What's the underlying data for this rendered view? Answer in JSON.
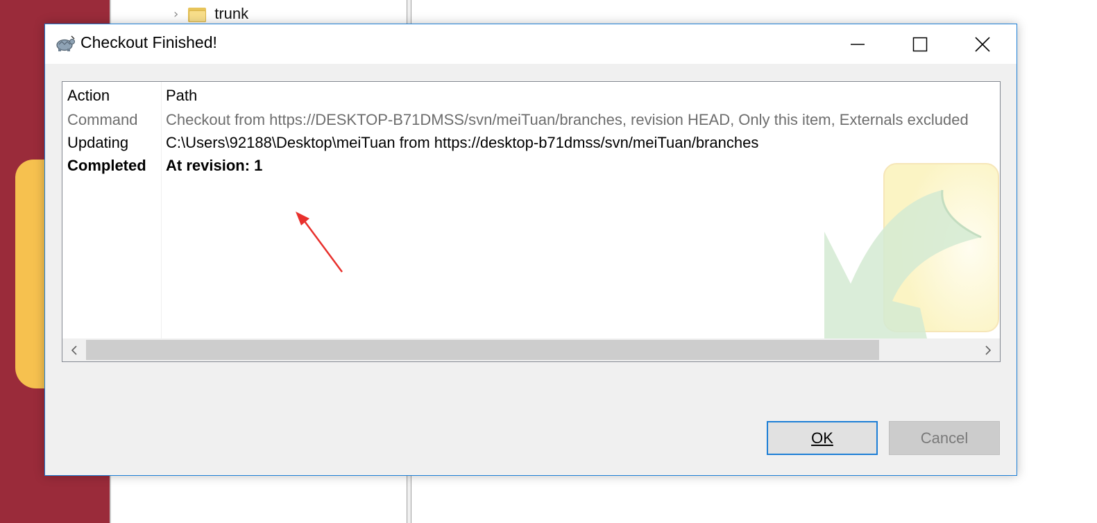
{
  "background": {
    "tree_item": {
      "label": "trunk",
      "icon": "folder-icon",
      "chevron": "›"
    }
  },
  "dialog": {
    "title": "Checkout Finished!",
    "title_icon": "tortoisesvn-icon",
    "window_buttons": [
      "minimize-icon",
      "maximize-icon",
      "close-icon"
    ],
    "columns": {
      "action": "Action",
      "path": "Path"
    },
    "rows": [
      {
        "action": "Command",
        "path": "Checkout from https://DESKTOP-B71DMSS/svn/meiTuan/branches, revision HEAD, Only this item, Externals excluded",
        "style": "gray"
      },
      {
        "action": "Updating",
        "path": "C:\\Users\\92188\\Desktop\\meiTuan from https://desktop-b71dmss/svn/meiTuan/branches",
        "style": "normal"
      },
      {
        "action": "Completed",
        "path": "At revision: 1",
        "style": "bold"
      }
    ],
    "scrollbar": {
      "left_arrow": "‹",
      "right_arrow": "›"
    },
    "buttons": {
      "ok": "OK",
      "cancel": "Cancel"
    },
    "colors": {
      "accent": "#1c7ed6",
      "annotation": "#e8302c",
      "background_app": "#9a2b3a"
    }
  }
}
